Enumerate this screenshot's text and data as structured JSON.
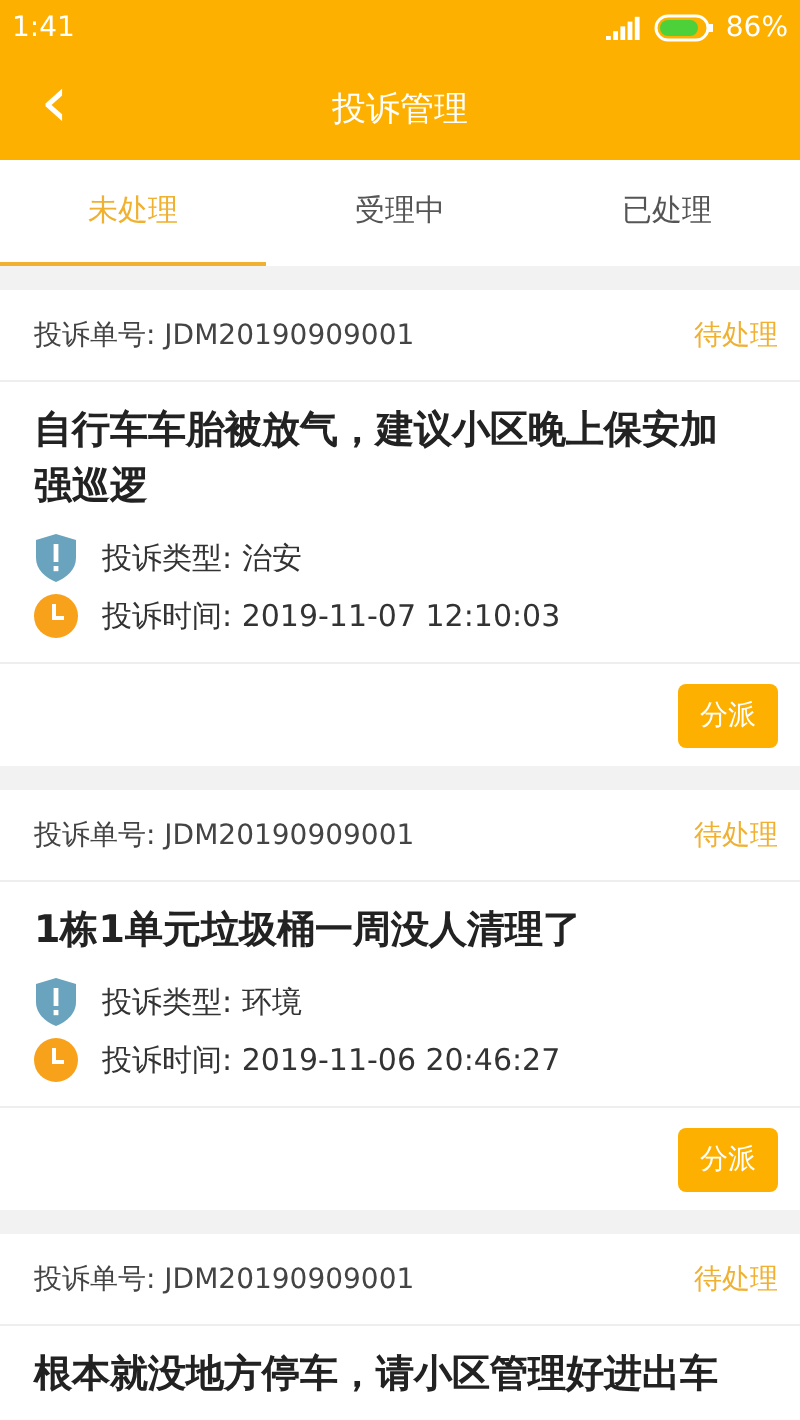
{
  "status_bar": {
    "time": "1:41",
    "battery": "86%"
  },
  "header": {
    "back": "‹",
    "title": "投诉管理"
  },
  "tabs": [
    {
      "label": "未处理",
      "selected": true
    },
    {
      "label": "受理中",
      "selected": false
    },
    {
      "label": "已处理",
      "selected": false
    }
  ],
  "complaints": [
    {
      "number": "投诉单号: JDM20190909001",
      "status": "待处理",
      "title": "自行车车胎被放气，建议小区晚上保安加强巡逻",
      "type": "投诉类型: 治安",
      "time": "投诉时间: 2019-11-07 12:10:03",
      "action": "分派"
    },
    {
      "number": "投诉单号: JDM20190909001",
      "status": "待处理",
      "title": "1栋1单元垃圾桶一周没人清理了",
      "type": "投诉类型: 环境",
      "time": "投诉时间: 2019-11-06 20:46:27",
      "action": "分派"
    },
    {
      "number": "投诉单号: JDM20190909001",
      "status": "待处理",
      "title": "根本就没地方停车，请小区管理好进出车"
    }
  ]
}
